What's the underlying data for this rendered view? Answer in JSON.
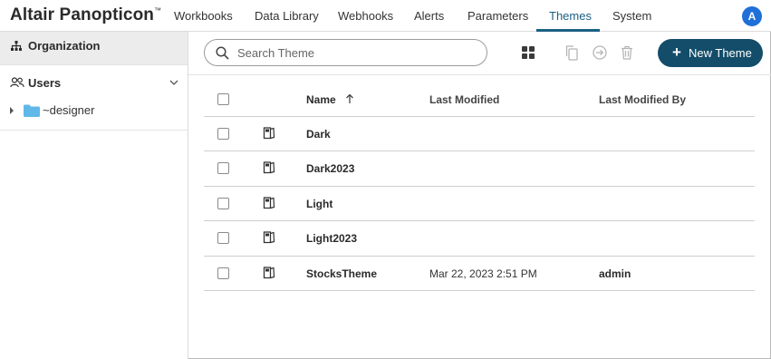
{
  "app": {
    "title": "Altair Panopticon",
    "trademark": "™",
    "user_initial": "A"
  },
  "nav": {
    "items": [
      {
        "label": "Workbooks",
        "active": false
      },
      {
        "label": "Data Library",
        "active": false
      },
      {
        "label": "Webhooks",
        "active": false
      },
      {
        "label": "Alerts",
        "active": false
      },
      {
        "label": "Parameters",
        "active": false
      },
      {
        "label": "Themes",
        "active": true
      },
      {
        "label": "System",
        "active": false
      }
    ]
  },
  "sidebar": {
    "organization_label": "Organization",
    "users_label": "Users",
    "tree": [
      {
        "label": "~designer",
        "icon": "folder-icon"
      }
    ]
  },
  "toolbar": {
    "search_placeholder": "Search Theme",
    "new_label": "New Theme",
    "new_icon": "+"
  },
  "table": {
    "columns": [
      "Name",
      "Last Modified",
      "Last Modified By"
    ],
    "sort_column": "Name",
    "sort_direction": "ascending",
    "rows": [
      {
        "name": "Dark",
        "modified": "",
        "modified_by": ""
      },
      {
        "name": "Dark2023",
        "modified": "",
        "modified_by": ""
      },
      {
        "name": "Light",
        "modified": "",
        "modified_by": ""
      },
      {
        "name": "Light2023",
        "modified": "",
        "modified_by": ""
      },
      {
        "name": "StocksTheme",
        "modified": "Mar 22, 2023 2:51 PM",
        "modified_by": "admin"
      }
    ]
  },
  "colors": {
    "accent": "#1a5f84",
    "primary_button": "#134d69",
    "avatar": "#1f6fd8",
    "folder": "#5fb8e8"
  }
}
